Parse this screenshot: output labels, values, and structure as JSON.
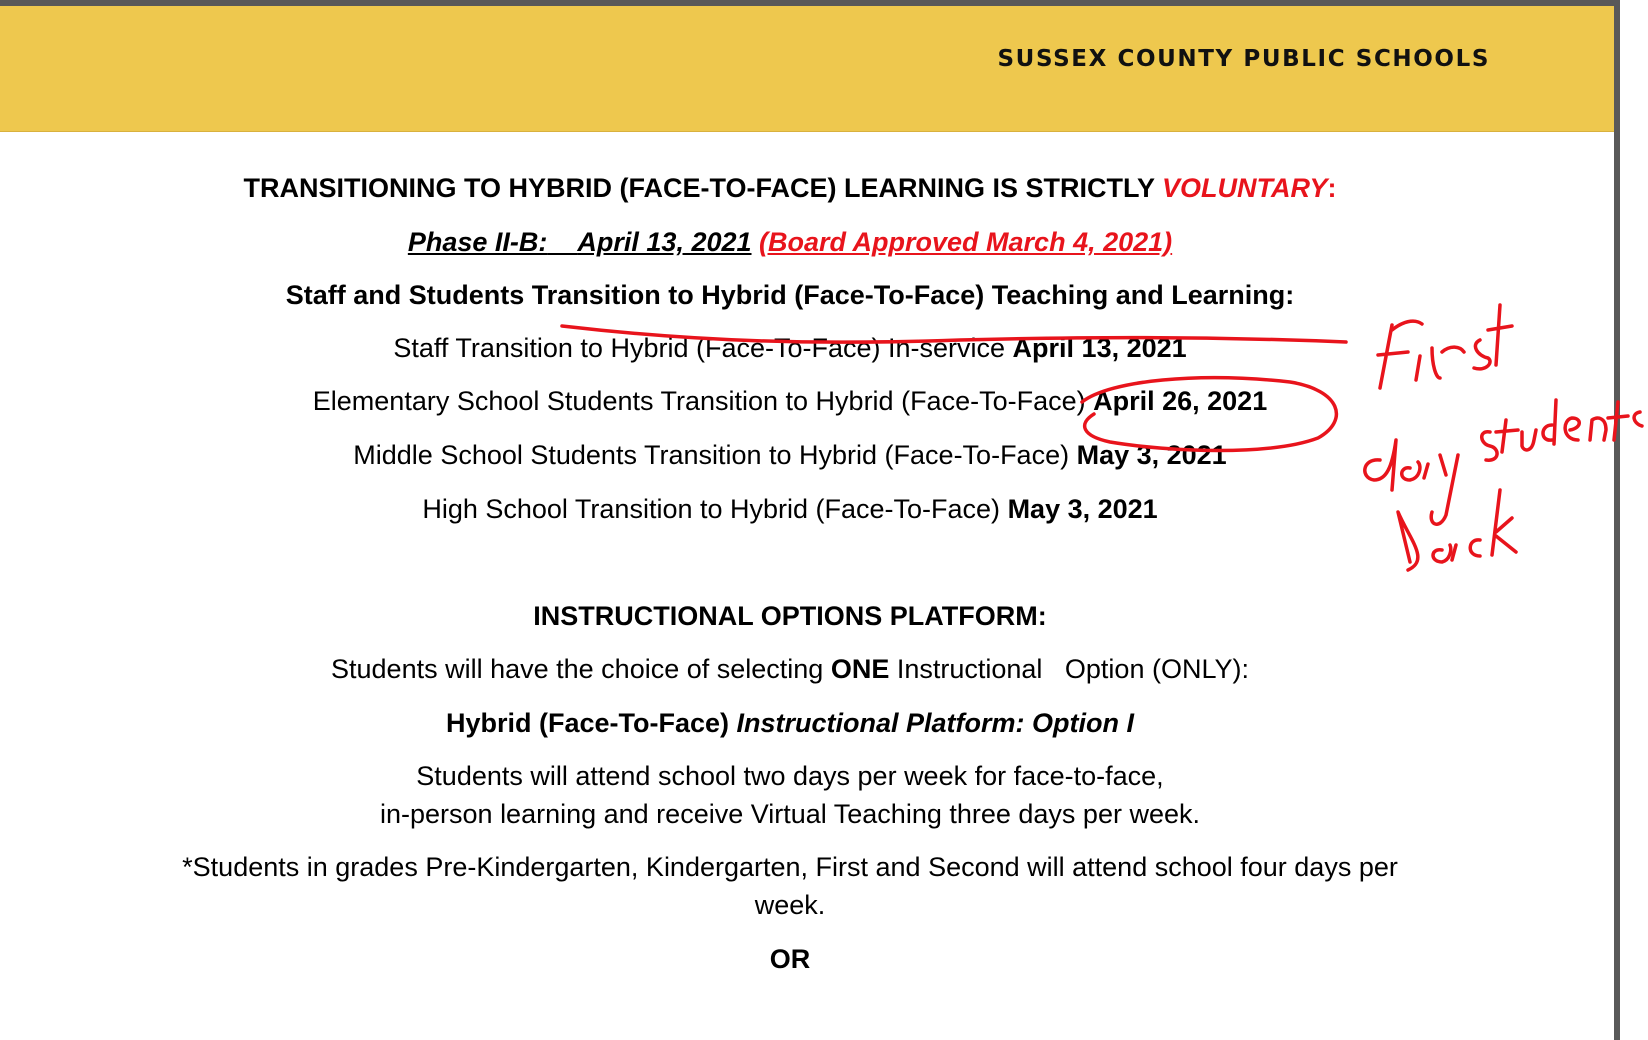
{
  "header": {
    "org_name": "SUSSEX COUNTY PUBLIC SCHOOLS",
    "band_color": "#eec84e"
  },
  "intro": {
    "title_prefix": "TRANSITIONING TO HYBRID (FACE-TO-FACE) LEARNING IS STRICTLY ",
    "title_emphasis": "VOLUNTARY",
    "title_suffix": ":"
  },
  "phase": {
    "label": "Phase II-B:",
    "date": "April 13, 2021",
    "approval": "(Board Approved March 4, 2021)"
  },
  "transition": {
    "heading": "Staff and Students Transition to Hybrid (Face-To-Face) Teaching and Learning:",
    "items": [
      {
        "text": "Staff Transition to Hybrid (Face-To-Face) In-service ",
        "date": "April 13, 2021"
      },
      {
        "text": "Elementary School Students Transition to Hybrid (Face-To-Face) ",
        "date": "April 26, 2021"
      },
      {
        "text": "Middle School Students Transition to Hybrid (Face-To-Face) ",
        "date": "May 3, 2021"
      },
      {
        "text": "High School Transition to Hybrid (Face-To-Face) ",
        "date": "May 3, 2021"
      }
    ]
  },
  "options": {
    "heading": "INSTRUCTIONAL OPTIONS PLATFORM:",
    "choice_prefix": "Students will have the choice of selecting ",
    "choice_emphasis": "ONE",
    "choice_suffix": " Instructional   Option (ONLY):",
    "option1_plain": "Hybrid (Face-To-Face) ",
    "option1_italic": "Instructional Platform: Option I",
    "option1_desc_line1": "Students will attend school two days per week for face-to-face,",
    "option1_desc_line2": "in-person learning and receive Virtual Teaching three days per week.",
    "note_line1": "*Students in grades Pre-Kindergarten, Kindergarten, First and Second will attend school four days per",
    "note_line2": "week.",
    "or_label": "OR"
  },
  "annotation": {
    "handwritten_note": "First day students back",
    "ink_color": "#e8141c"
  }
}
